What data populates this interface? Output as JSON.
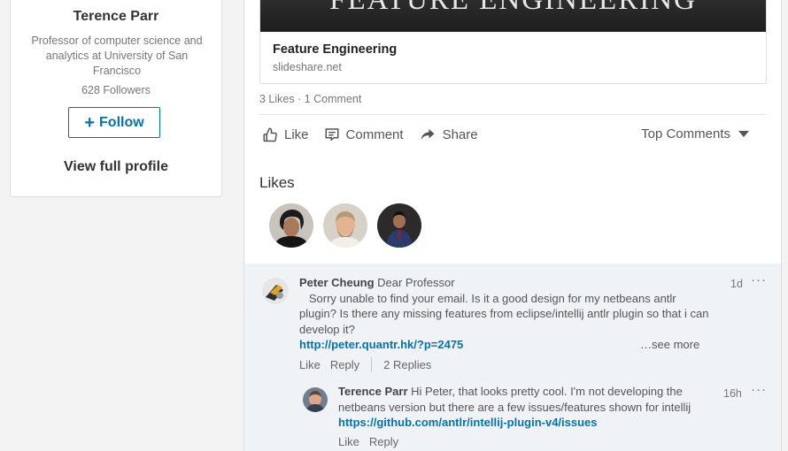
{
  "profile": {
    "name": "Terence Parr",
    "headline": "Professor of computer science and analytics at University of San Francisco",
    "followers": "628 Followers",
    "follow_label": "Follow",
    "follow_icon": "plus-icon",
    "view_profile_label": "View full profile"
  },
  "post": {
    "article": {
      "image_text": "FEATURE ENGINEERING",
      "title": "Feature Engineering",
      "source": "slideshare.net"
    },
    "social_counts": "3 Likes · 1 Comment",
    "actions": {
      "like": "Like",
      "comment": "Comment",
      "share": "Share"
    },
    "sort_label": "Top Comments",
    "likes_heading": "Likes",
    "likers": [
      "liker-1",
      "liker-2",
      "liker-3"
    ]
  },
  "comments": [
    {
      "author": "Peter Cheung",
      "text_prefix": "Dear Professor",
      "text_body": "Sorry unable to find your email. Is it a good design for my netbeans antlr plugin? Is there any missing features from eclipse/intellij antlr plugin so that i can develop it?",
      "link": "http://peter.quantr.hk/?p=2475",
      "see_more": "…see more",
      "time": "1d",
      "like": "Like",
      "reply": "Reply",
      "replies_count": "2 Replies"
    },
    {
      "author": "Terence Parr",
      "text": "Hi Peter, that looks pretty cool. I'm not developing the netbeans version but there are a few issues/features shown for intellij",
      "link": "https://github.com/antlr/intellij-plugin-v4/issues",
      "time": "16h",
      "like": "Like",
      "reply": "Reply"
    }
  ],
  "colors": {
    "accent": "#0073b1",
    "comments_bg": "#eff3f6",
    "page_bg": "#f3f3f3"
  }
}
